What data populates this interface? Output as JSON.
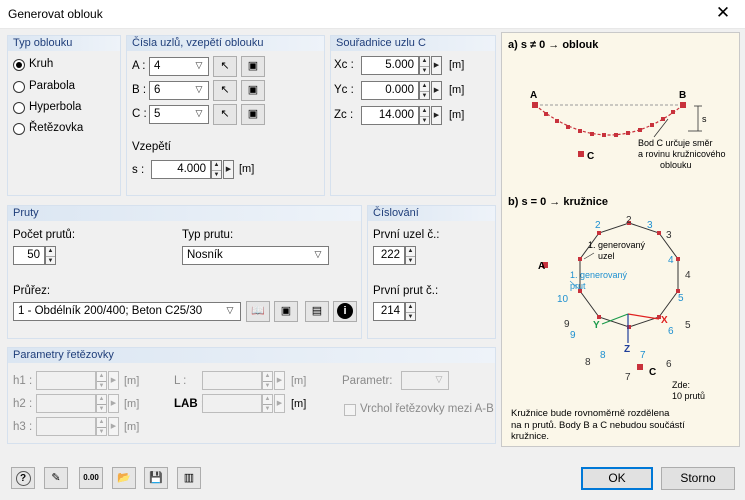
{
  "window": {
    "title": "Generovat oblouk",
    "close_glyph": "✕"
  },
  "typ_oblouku": {
    "header": "Typ oblouku",
    "options": [
      {
        "label": "Kruh",
        "selected": true
      },
      {
        "label": "Parabola",
        "selected": false
      },
      {
        "label": "Hyperbola",
        "selected": false
      },
      {
        "label": "Řetězovka",
        "selected": false
      }
    ]
  },
  "cisla_uzlu": {
    "header": "Čísla uzlů, vzepětí oblouku",
    "rows": [
      {
        "label": "A :",
        "value": "4"
      },
      {
        "label": "B :",
        "value": "6"
      },
      {
        "label": "C :",
        "value": "5"
      }
    ],
    "vzepeti_label": "Vzepětí",
    "s_label": "s :",
    "s_value": "4.000",
    "s_unit": "[m]"
  },
  "souradnice": {
    "header": "Souřadnice uzlu C",
    "rows": [
      {
        "label": "Xc :",
        "value": "5.000",
        "unit": "[m]"
      },
      {
        "label": "Yc :",
        "value": "0.000",
        "unit": "[m]"
      },
      {
        "label": "Zc :",
        "value": "14.000",
        "unit": "[m]"
      }
    ]
  },
  "pruty": {
    "header": "Pruty",
    "pocet_label": "Počet prutů:",
    "pocet_value": "50",
    "typ_label": "Typ prutu:",
    "typ_value": "Nosník",
    "prurez_label": "Průřez:",
    "prurez_value": "1 - Obdélník 200/400; Beton C25/30"
  },
  "cislovani": {
    "header": "Číslování",
    "uzel_label": "První uzel č.:",
    "uzel_value": "222",
    "prut_label": "První prut č.:",
    "prut_value": "214"
  },
  "retezovka": {
    "header": "Parametry řetězovky",
    "h1": "h1 :",
    "h2": "h2 :",
    "h3": "h3 :",
    "L": "L :",
    "LAB": "LAB :",
    "parametr": "Parametr:",
    "unit": "[m]",
    "vrchol_label": "Vrchol řetězovky mezi A-B"
  },
  "illustration": {
    "a_title": "a) s ≠ 0 → oblouk",
    "b_title": "b) s = 0 → kružnice",
    "point_A": "A",
    "point_B": "B",
    "point_C": "C",
    "s_mark": "s",
    "note_c": [
      "Bod C určuje směr",
      "a rovinu kružnicového",
      "oblouku"
    ],
    "node_gen": [
      "1. generovaný",
      "uzel"
    ],
    "member_gen": [
      "1. generovaný",
      "prut"
    ],
    "zde": [
      "Zde:",
      "10 prutů"
    ],
    "footer": [
      "Kružnice bude rovnoměrně rozdělena",
      "na n prutů. Body B a C nebudou součástí",
      "kružnice."
    ],
    "node_numbers": [
      "1",
      "2",
      "3",
      "4",
      "5",
      "6",
      "7",
      "8",
      "9",
      "10"
    ],
    "member_numbers": [
      "1",
      "2",
      "3",
      "4",
      "5",
      "6",
      "7",
      "8",
      "9",
      "10"
    ],
    "axis_labels": [
      "X",
      "Y",
      "Z"
    ],
    "colors": {
      "node": "#c8323c",
      "member": "#1e90d0",
      "x_axis": "#e02020",
      "y_axis": "#1a9a4a",
      "z_axis": "#1f3e9a"
    }
  },
  "footer": {
    "icons": [
      "help-icon",
      "edit-icon",
      "units-icon",
      "open-icon",
      "save-icon",
      "library-icon"
    ],
    "units_text": "0.00",
    "ok": "OK",
    "cancel": "Storno"
  }
}
